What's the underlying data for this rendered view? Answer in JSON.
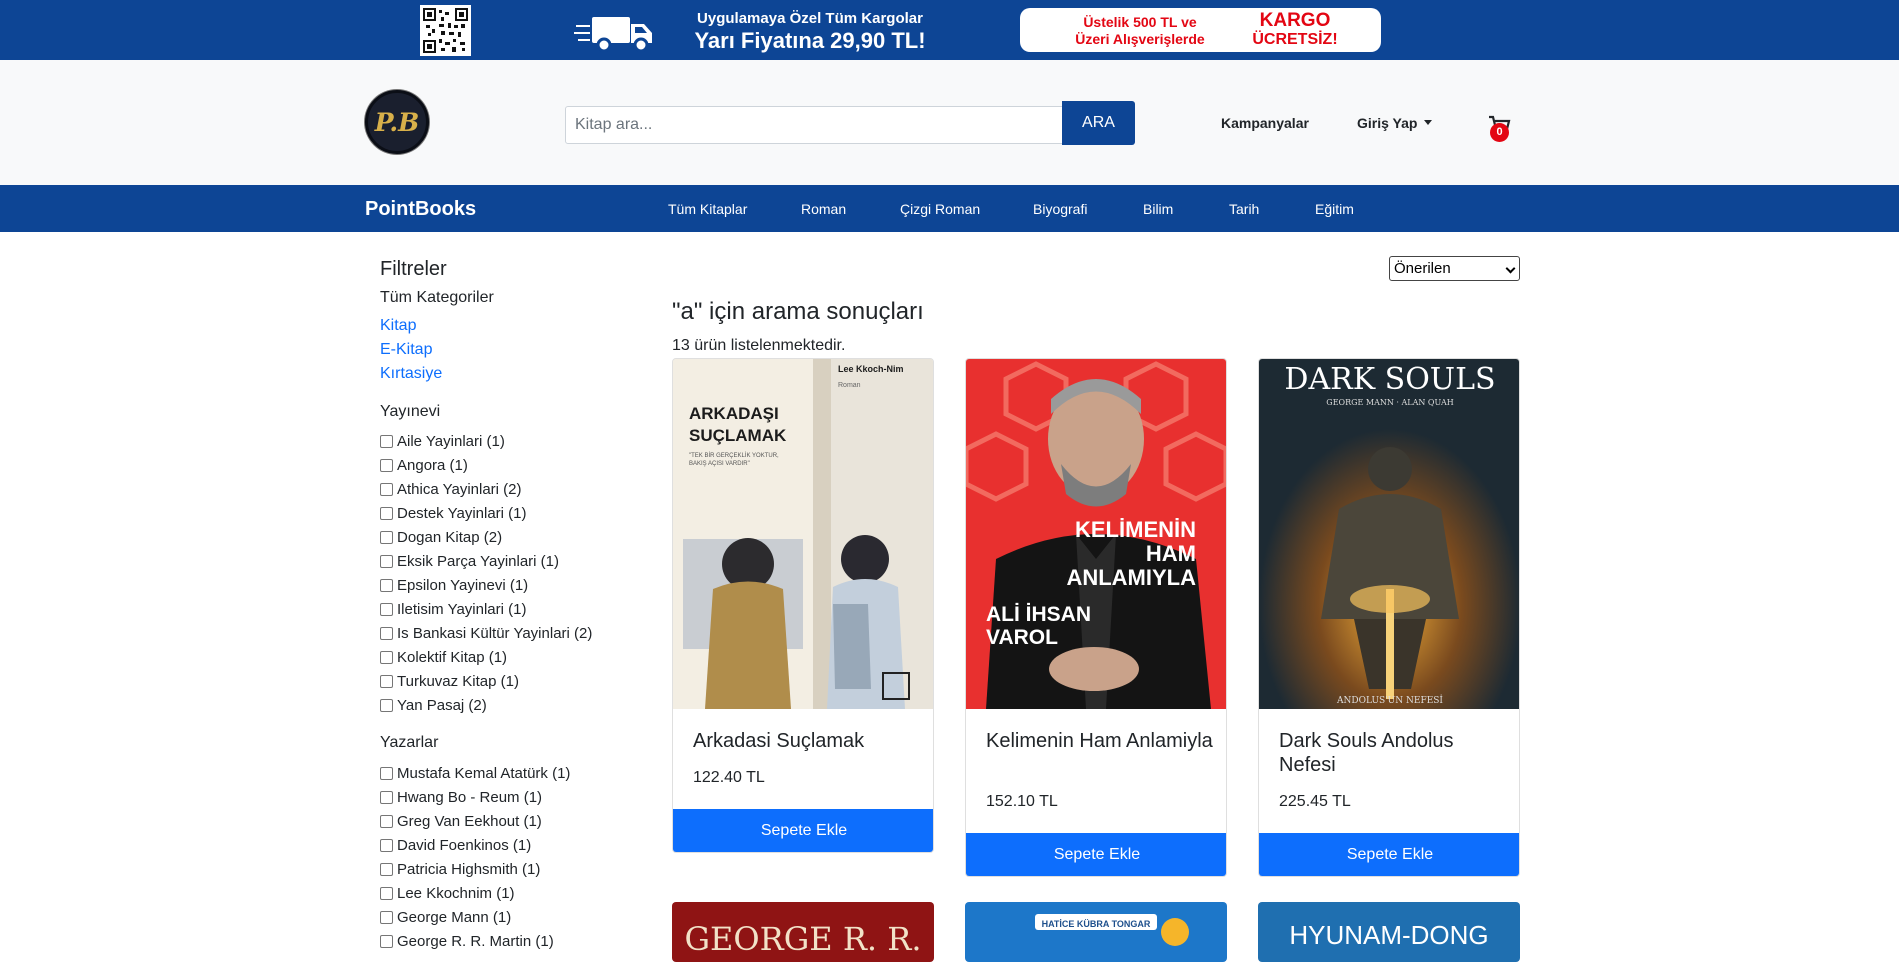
{
  "banner": {
    "promo_line1": "Uygulamaya Özel Tüm Kargolar",
    "promo_line2": "Yarı Fiyatına 29,90 TL!",
    "box_left_line1": "Üstelik 500 TL ve",
    "box_left_line2": "Üzeri Alışverişlerde",
    "box_right_line1": "KARGO",
    "box_right_line2": "ÜCRETSİZ!"
  },
  "header": {
    "logo_text": "P.B",
    "search_placeholder": "Kitap ara...",
    "search_button": "ARA",
    "campaigns": "Kampanyalar",
    "login": "Giriş Yap",
    "cart_count": "0"
  },
  "nav": {
    "brand": "PointBooks",
    "items": [
      "Tüm Kitaplar",
      "Roman",
      "Çizgi Roman",
      "Biyografi",
      "Bilim",
      "Tarih",
      "Eğitim"
    ]
  },
  "filters": {
    "title": "Filtreler",
    "categories_title": "Tüm Kategoriler",
    "categories": [
      "Kitap",
      "E-Kitap",
      "Kırtasiye"
    ],
    "publisher_title": "Yayınevi",
    "publishers": [
      "Aile Yayinlari (1)",
      "Angora (1)",
      "Athica Yayinlari (2)",
      "Destek Yayinlari (1)",
      "Dogan Kitap (2)",
      "Eksik Parça Yayinlari (1)",
      "Epsilon Yayinevi (1)",
      "Iletisim Yayinlari (1)",
      "Is Bankasi Kültür Yayinlari (2)",
      "Kolektif Kitap (1)",
      "Turkuvaz Kitap (1)",
      "Yan Pasaj (2)"
    ],
    "author_title": "Yazarlar",
    "authors": [
      "Mustafa Kemal Atatürk (1)",
      "Hwang Bo - Reum (1)",
      "Greg Van Eekhout (1)",
      "David Foenkinos (1)",
      "Patricia Highsmith (1)",
      "Lee Kkochnim (1)",
      "George Mann (1)",
      "George R. R. Martin (1)"
    ]
  },
  "results": {
    "sort_selected": "Önerilen",
    "title": "\"a\" için arama sonuçları",
    "count_text": "13 ürün listelenmektedir.",
    "products": [
      {
        "name": "Arkadasi Suçlamak",
        "price": "122.40 TL",
        "button": "Sepete Ekle",
        "cover_texts": [
          "ARKADAŞI",
          "SUÇLAMAK",
          "Lee Kkoch-Nim",
          "Roman",
          "\"TEK BİR GERÇEKLİK YOKTUR,",
          "BAKIŞ AÇISI VARDIR\""
        ]
      },
      {
        "name": "Kelimenin Ham Anlamiyla",
        "price": "152.10 TL",
        "button": "Sepete Ekle",
        "cover_texts": [
          "KELİMENİN",
          "HAM",
          "ANLAMIYLA",
          "ALİ İHSAN",
          "VAROL"
        ]
      },
      {
        "name": "Dark Souls Andolus Nefesi",
        "price": "225.45 TL",
        "button": "Sepete Ekle",
        "cover_texts": [
          "DARK SOULS",
          "GEORGE MANN · ALAN QUAH",
          "ANDOLUS'UN NEFESİ"
        ]
      }
    ],
    "next_row_cover_texts": [
      "GEORGE R. R.",
      "HATİCE KÜBRA TONGAR",
      "HYUNAM-DONG"
    ]
  },
  "colors": {
    "brand_blue": "#0d4595",
    "primary_button": "#0d6efd",
    "link": "#0d6efd",
    "badge_red": "#e30613"
  }
}
